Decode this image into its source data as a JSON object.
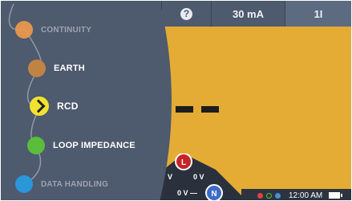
{
  "topbar": {
    "help_icon": "?",
    "current": "30 mA",
    "mode": "1I"
  },
  "display": {
    "reading": "— —"
  },
  "leads": {
    "l_label": "L",
    "n_label": "N",
    "v_left": "V",
    "v_right": "0 V",
    "v_bottom": "0 V —"
  },
  "menu": {
    "items": [
      {
        "label": "CONTINUITY",
        "color": "#ef9a4b",
        "state": "dim"
      },
      {
        "label": "EARTH",
        "color": "#c18343",
        "state": "normal"
      },
      {
        "label": "RCD",
        "color": "#f3e22d",
        "state": "selected"
      },
      {
        "label": "LOOP IMPEDANCE",
        "color": "#5bbd3c",
        "state": "normal"
      },
      {
        "label": "DATA HANDLING",
        "color": "#2b96d8",
        "state": "dim"
      }
    ]
  },
  "status": {
    "time": "12:00 AM",
    "dots": [
      "#e0433f",
      "#5bbd3c",
      "#3f8fd8"
    ]
  },
  "colors": {
    "screen": "#e4ac34",
    "panel": "#4e5a6e",
    "topbar": "#4e5a6e"
  }
}
